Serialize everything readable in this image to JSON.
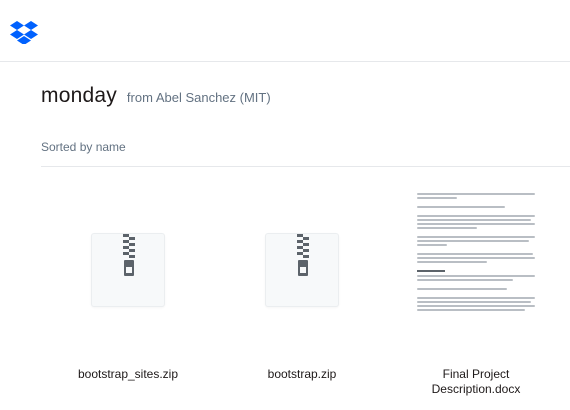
{
  "header": {
    "logo_icon": "dropbox-logo-icon",
    "brand_color": "#0061fe"
  },
  "folder": {
    "title": "monday",
    "owner": "from Abel Sanchez (MIT)"
  },
  "sort": {
    "label": "Sorted by name"
  },
  "files": [
    {
      "name": "bootstrap_sites.zip",
      "type": "zip",
      "icon": "zip-file-icon"
    },
    {
      "name": "bootstrap.zip",
      "type": "zip",
      "icon": "zip-file-icon"
    },
    {
      "name": "Final Project Description.docx",
      "type": "docx",
      "icon": "document-preview"
    }
  ],
  "colors": {
    "text_primary": "#1e1919",
    "text_secondary": "#637282",
    "divider": "#e6e8eb",
    "zipper": "#5c636a"
  }
}
